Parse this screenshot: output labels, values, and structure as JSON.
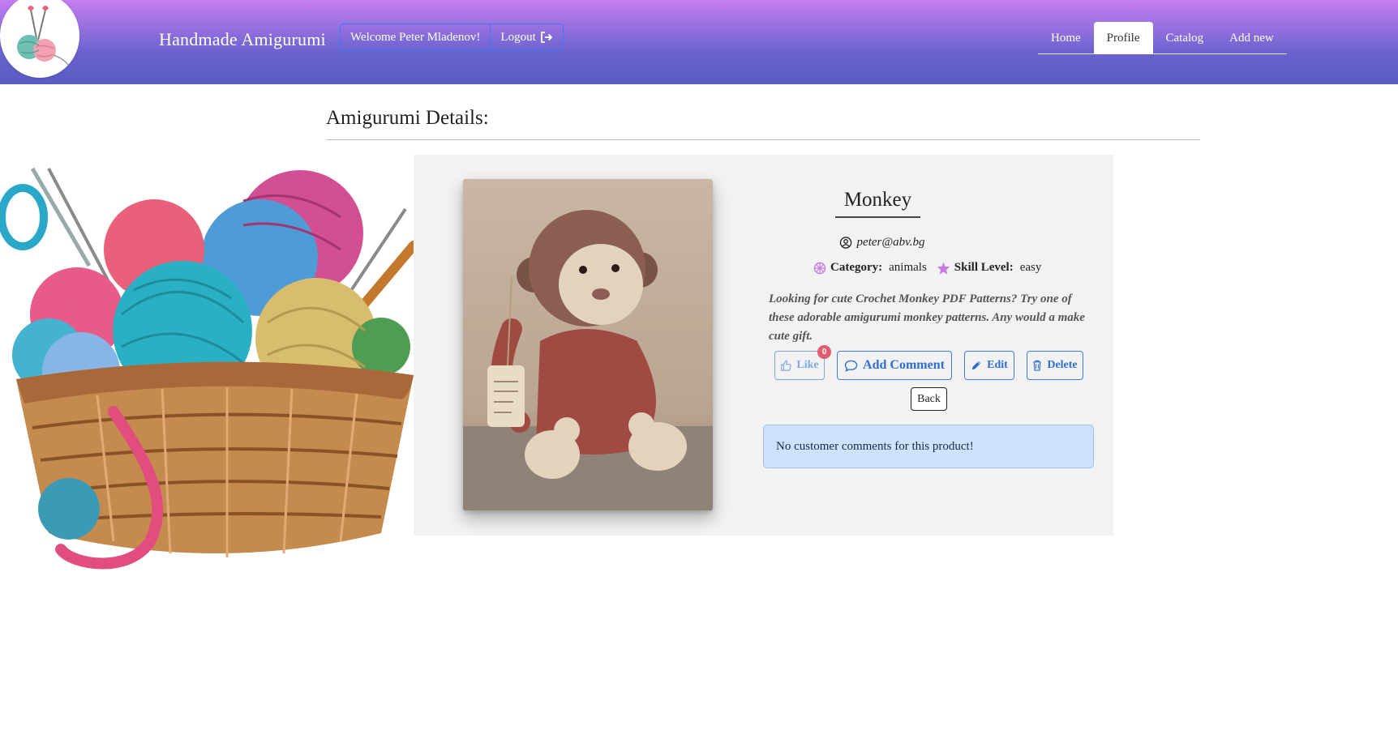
{
  "header": {
    "site_title": "Handmade Amigurumi",
    "welcome": "Welcome Peter Mladenov!",
    "logout_label": "Logout",
    "logout_icon": "logout-icon",
    "logo": "yarn-logo"
  },
  "nav": {
    "items": [
      {
        "label": "Home",
        "active": false
      },
      {
        "label": "Profile",
        "active": true
      },
      {
        "label": "Catalog",
        "active": false
      },
      {
        "label": "Add new",
        "active": false
      }
    ]
  },
  "page": {
    "heading": "Amigurumi Details:"
  },
  "product": {
    "name": "Monkey",
    "owner_email": "peter@abv.bg",
    "owner_icon": "user-circle-icon",
    "category_label": "Category:",
    "category_value": "animals",
    "category_icon": "flower-icon",
    "skill_label": "Skill Level:",
    "skill_value": "easy",
    "skill_icon": "star-icon",
    "description": "Looking for cute Crochet Monkey PDF Patterns? Try one of these adorable amigurumi monkey patterns. Any would a make cute gift.",
    "image": "crochet-monkey-photo"
  },
  "actions": {
    "like_label": "Like",
    "like_count": "0",
    "comment_label": "Add Comment",
    "edit_label": "Edit",
    "delete_label": "Delete",
    "back_label": "Back"
  },
  "comments": {
    "empty_message": "No customer comments for this product!"
  },
  "colors": {
    "header_gradient_top": "#c57cf0",
    "header_gradient_bottom": "#5a5cc4",
    "accent_blue": "#2d6fd6",
    "alert_bg": "#cfe2fb",
    "badge": "#e05d6f",
    "icon_purple": "#c77ddf"
  }
}
